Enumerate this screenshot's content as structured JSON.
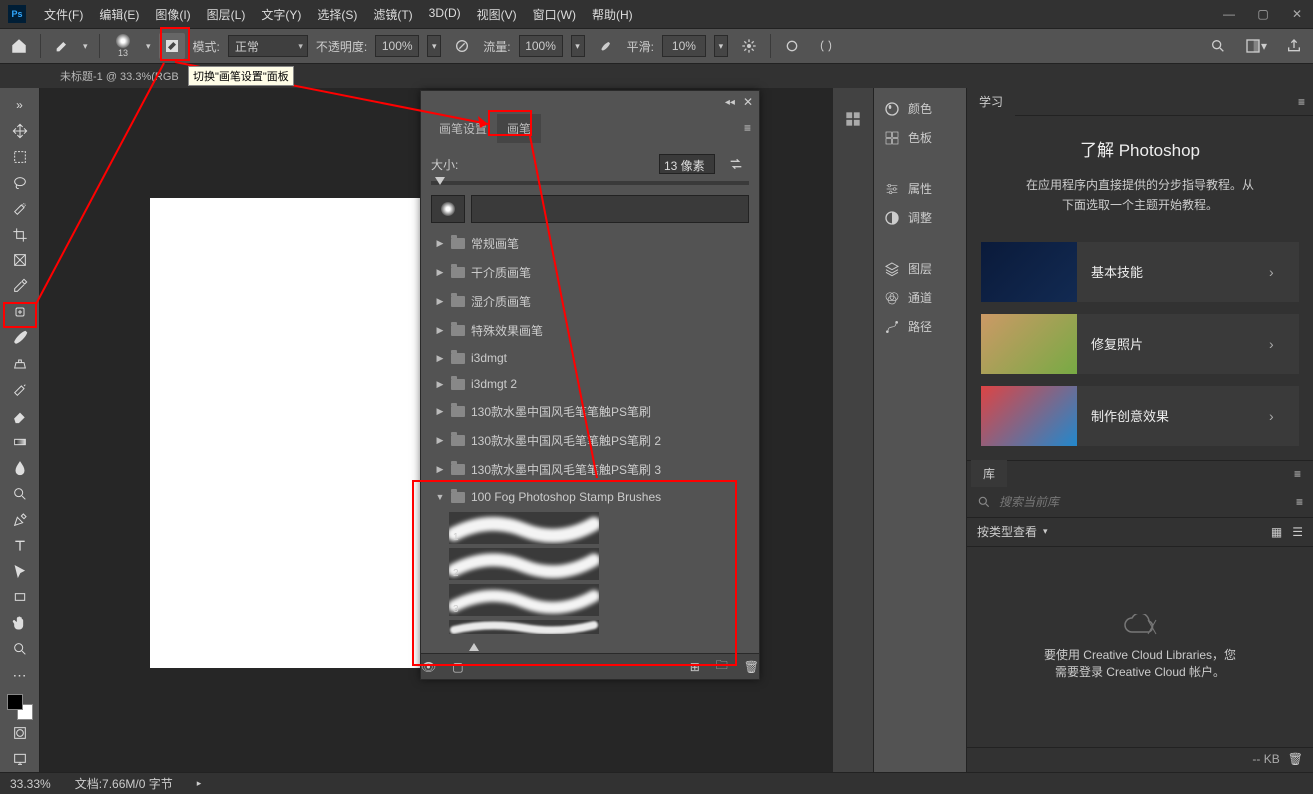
{
  "app": {
    "logo": "Ps"
  },
  "menu": [
    "文件(F)",
    "编辑(E)",
    "图像(I)",
    "图层(L)",
    "文字(Y)",
    "选择(S)",
    "滤镜(T)",
    "3D(D)",
    "视图(V)",
    "窗口(W)",
    "帮助(H)"
  ],
  "optionsbar": {
    "mode_label": "模式:",
    "mode_value": "正常",
    "opacity_label": "不透明度:",
    "opacity_value": "100%",
    "flow_label": "流量:",
    "flow_value": "100%",
    "smooth_label": "平滑:",
    "smooth_value": "10%",
    "brush_size": "13"
  },
  "tooltip": "切换\"画笔设置\"面板",
  "doc_tab": "未标题-1 @ 33.3%(RGB",
  "brush_panel": {
    "tab1": "画笔设置",
    "tab2": "画笔",
    "size_label": "大小:",
    "size_value": "13 像素",
    "folders": [
      "常规画笔",
      "干介质画笔",
      "湿介质画笔",
      "特殊效果画笔",
      "i3dmgt",
      "i3dmgt 2",
      "130款水墨中国风毛笔笔触PS笔刷",
      "130款水墨中国风毛笔笔触PS笔刷 2",
      "130款水墨中国风毛笔笔触PS笔刷 3"
    ],
    "open_folder": "100 Fog Photoshop Stamp Brushes",
    "brush_nums": [
      "1",
      "2",
      "3"
    ]
  },
  "mini_panels": [
    "颜色",
    "色板",
    "属性",
    "调整",
    "图层",
    "通道",
    "路径"
  ],
  "learn": {
    "tab": "学习",
    "title": "了解 Photoshop",
    "desc1": "在应用程序内直接提供的分步指导教程。从",
    "desc2": "下面选取一个主题开始教程。",
    "cards": [
      "基本技能",
      "修复照片",
      "制作创意效果"
    ]
  },
  "lib": {
    "tab": "库",
    "search_placeholder": "搜索当前库",
    "view_label": "按类型查看",
    "msg1": "要使用 Creative Cloud Libraries，您",
    "msg2": "需要登录 Creative Cloud 帐户。"
  },
  "status": {
    "zoom": "33.33%",
    "docinfo": "文档:7.66M/0 字节",
    "kb": "-- KB"
  }
}
